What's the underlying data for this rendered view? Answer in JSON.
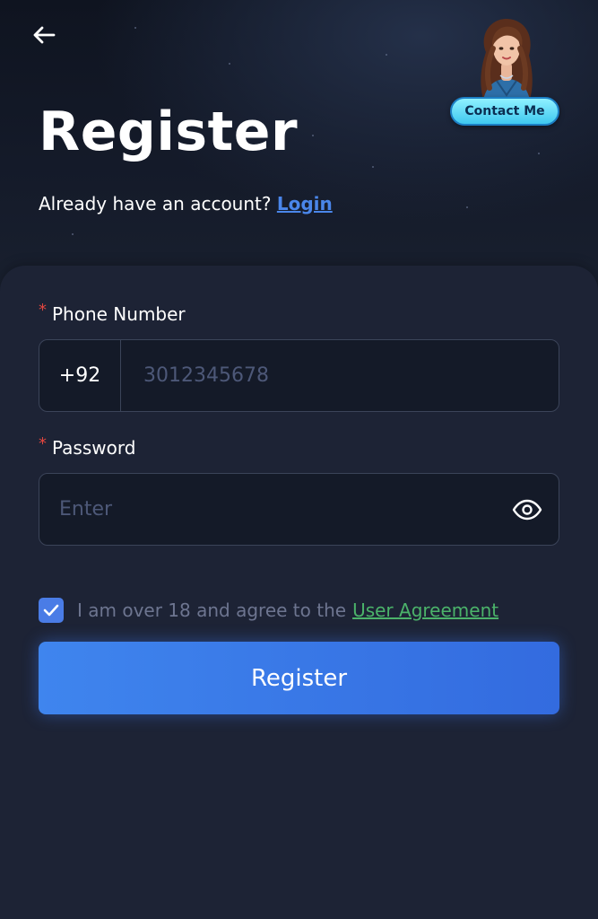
{
  "header": {
    "title": "Register",
    "login_prompt": "Already have an account?",
    "login_link": "Login"
  },
  "contact": {
    "label": "Contact Me"
  },
  "form": {
    "phone": {
      "label": "Phone Number",
      "country_code": "+92",
      "placeholder": "3012345678"
    },
    "password": {
      "label": "Password",
      "placeholder": "Enter"
    },
    "agreement": {
      "checked": true,
      "text": "I am over 18 and agree to the",
      "link": "User Agreement"
    },
    "submit_label": "Register"
  },
  "colors": {
    "background": "#1d2335",
    "accent_blue": "#3f85ee",
    "link_blue": "#4a86ea",
    "agreement_link_green": "#4bb36a",
    "required_red": "#e2463f",
    "contact_button": "#3fc8ef"
  },
  "icons": {
    "back": "arrow-left-icon",
    "password_visibility": "eye-icon",
    "agreement_check": "checkmark-icon"
  }
}
